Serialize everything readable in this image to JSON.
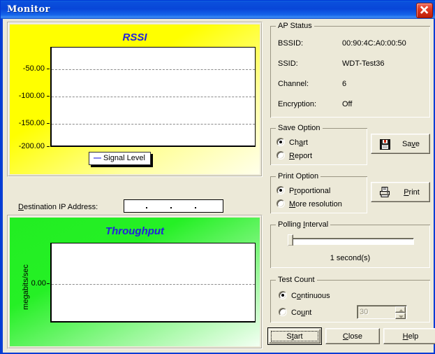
{
  "window": {
    "title": "Monitor",
    "close_icon": "close-icon"
  },
  "rssi_chart": {
    "title": "RSSI",
    "legend": "Signal Level",
    "legend_dash": "—",
    "bg_color": "#ffff00",
    "title_color": "#2222dd"
  },
  "throughput_chart": {
    "title": "Throughput",
    "ylabel": "megabits/sec",
    "bg_color": "#22ee22",
    "title_color": "#2222dd"
  },
  "destination": {
    "label_a": "D",
    "label_b": "estination IP Address:",
    "value": ""
  },
  "ap_status": {
    "group_label": "AP Status",
    "rows": [
      {
        "label": "BSSID:",
        "value": "00:90:4C:A0:00:50"
      },
      {
        "label": "SSID:",
        "value": "WDT-Test36"
      },
      {
        "label": "Channel:",
        "value": "6"
      },
      {
        "label": "Encryption:",
        "value": "Off"
      }
    ]
  },
  "save_option": {
    "group_label": "Save Option",
    "options": [
      {
        "pre": "Ch",
        "ak": "a",
        "post": "rt",
        "selected": true
      },
      {
        "pre": "",
        "ak": "R",
        "post": "eport",
        "selected": false
      }
    ],
    "button": {
      "pre": "Sa",
      "ak": "v",
      "post": "e",
      "icon": "floppy-disk-icon"
    }
  },
  "print_option": {
    "group_label": "Print Option",
    "options": [
      {
        "pre": "P",
        "ak": "r",
        "post": "oportional",
        "selected": true
      },
      {
        "pre": "",
        "ak": "M",
        "post": "ore resolution",
        "selected": false
      }
    ],
    "button": {
      "pre": "",
      "ak": "P",
      "post": "rint",
      "icon": "printer-icon"
    }
  },
  "polling_interval": {
    "group_label_pre": "Polling ",
    "group_label_ak": "I",
    "group_label_post": "nterval",
    "value_text": "1 second(s)",
    "slider_position_pct": 0
  },
  "test_count": {
    "group_label": "Test Count",
    "options": [
      {
        "pre": "C",
        "ak": "o",
        "post": "ntinuous",
        "selected": true
      },
      {
        "pre": "Co",
        "ak": "u",
        "post": "nt",
        "selected": false
      }
    ],
    "count_value": "30",
    "count_enabled": false
  },
  "footer": {
    "start": {
      "pre": "S",
      "ak": "t",
      "post": "art",
      "default": true
    },
    "close": {
      "pre": "",
      "ak": "C",
      "post": "lose"
    },
    "help": {
      "pre": "",
      "ak": "H",
      "post": "elp"
    }
  },
  "chart_data": [
    {
      "type": "line",
      "title": "RSSI",
      "xlabel": "",
      "ylabel": "",
      "ytick_labels": [
        "-50.00",
        "-100.00",
        "-150.00",
        "-200.00"
      ],
      "yticks": [
        -50,
        -100,
        -150,
        -200
      ],
      "ylim": [
        -200,
        -25
      ],
      "grid": true,
      "legend": [
        "Signal Level"
      ],
      "legend_position": "bottom-center",
      "series": [
        {
          "name": "Signal Level",
          "x": [],
          "values": []
        }
      ],
      "background": "#ffff00"
    },
    {
      "type": "line",
      "title": "Throughput",
      "xlabel": "",
      "ylabel": "megabits/sec",
      "ytick_labels": [
        "0.00"
      ],
      "yticks": [
        0
      ],
      "ylim": [
        -1,
        1
      ],
      "grid": true,
      "legend": [],
      "series": [
        {
          "name": "Throughput",
          "x": [],
          "values": []
        }
      ],
      "background": "#22ee22"
    }
  ]
}
